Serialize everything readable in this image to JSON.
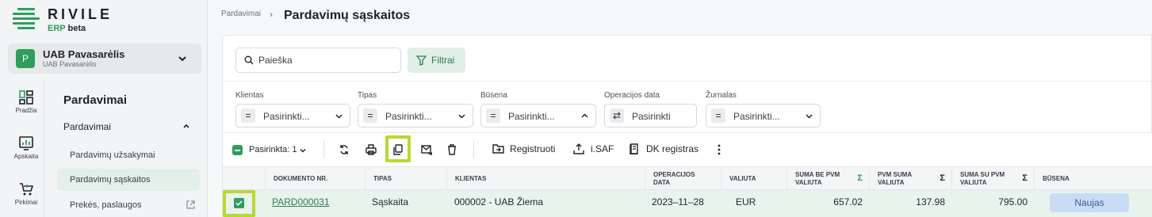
{
  "brand": {
    "name": "RIVILE",
    "erp": "ERP",
    "beta": "beta",
    "accent": "#2e9e5b"
  },
  "company": {
    "initial": "P",
    "name": "UAB Pavasarėlis",
    "subtitle": "UAB Pavasarėlis"
  },
  "rail": [
    {
      "label": "Pradžia",
      "icon": "dashboard-icon"
    },
    {
      "label": "Apskaita",
      "icon": "chart-icon"
    },
    {
      "label": "Pirkimai",
      "icon": "cart-icon"
    }
  ],
  "nav": {
    "title": "Pardavimai",
    "group": "Pardavimai",
    "items": [
      "Pardavimų užsakymai",
      "Pardavimų sąskaitos",
      "Prekės, paslaugos"
    ]
  },
  "breadcrumb": {
    "parent": "Pardavimai",
    "separator": "›",
    "current": "Pardavimų sąskaitos"
  },
  "search": {
    "placeholder": "Paieška"
  },
  "filters_button": "Filtrai",
  "filters": [
    {
      "label": "Klientas",
      "operator": "=",
      "value": "Pasirinkti..."
    },
    {
      "label": "Tipas",
      "operator": "=",
      "value": "Pasirinkti..."
    },
    {
      "label": "Būsena",
      "operator": "=",
      "value": "Pasirinkti..."
    },
    {
      "label": "Operacijos data",
      "operator": "⇄",
      "value": "Pasirinkti"
    },
    {
      "label": "Žurnalas",
      "operator": "=",
      "value": "Pasirinkti..."
    }
  ],
  "actions": {
    "selected": "Pasirinkta: 1",
    "register": "Registruoti",
    "isaf": "i.SAF",
    "dk": "DK registras"
  },
  "table": {
    "columns": [
      {
        "line1": "DOKUMENTO NR.",
        "line2": ""
      },
      {
        "line1": "TIPAS",
        "line2": ""
      },
      {
        "line1": "KLIENTAS",
        "line2": ""
      },
      {
        "line1": "OPERACIJOS",
        "line2": "DATA"
      },
      {
        "line1": "VALIUTA",
        "line2": ""
      },
      {
        "line1": "SUMA BE PVM",
        "line2": "VALIUTA"
      },
      {
        "line1": "PVM SUMA",
        "line2": "VALIUTA"
      },
      {
        "line1": "SUMA SU PVM",
        "line2": "VALIUTA"
      },
      {
        "line1": "BŪSENA",
        "line2": ""
      }
    ],
    "sigma": "Σ",
    "rows": [
      {
        "doc": "PARD000031",
        "type": "Sąskaita",
        "client": "000002 - UAB Žiema",
        "date": "2023–11–28",
        "currency": "EUR",
        "net": "657.02",
        "vat": "137.98",
        "gross": "795.00",
        "status": "Naujas"
      }
    ]
  }
}
